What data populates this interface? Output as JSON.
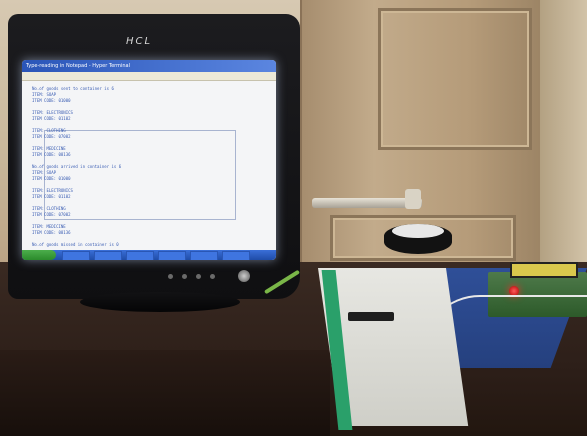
{
  "monitor": {
    "brand": "HCL",
    "window_title": "Type-reading in Notepad - Hyper Terminal",
    "screen_lines": [
      "No.of goods sent to container is 6",
      "ITEM: SOAP",
      "ITEM CODE: 01000",
      "",
      "ITEM: ELECTRONICS",
      "ITEM CODE: 01102",
      "",
      "ITEM: CLOTHING",
      "ITEM CODE: 07002",
      "",
      "ITEM: MEDICINE",
      "ITEM CODE: 08136",
      "",
      "No.of goods arrived in container is 6",
      "ITEM: SOAP",
      "ITEM CODE: 01000",
      "",
      "ITEM: ELECTRONICS",
      "ITEM CODE: 01102",
      "",
      "ITEM: CLOTHING",
      "ITEM CODE: 07002",
      "",
      "ITEM: MEDICINE",
      "ITEM CODE: 08136",
      "",
      "No.of goods missed in container is 0"
    ]
  }
}
